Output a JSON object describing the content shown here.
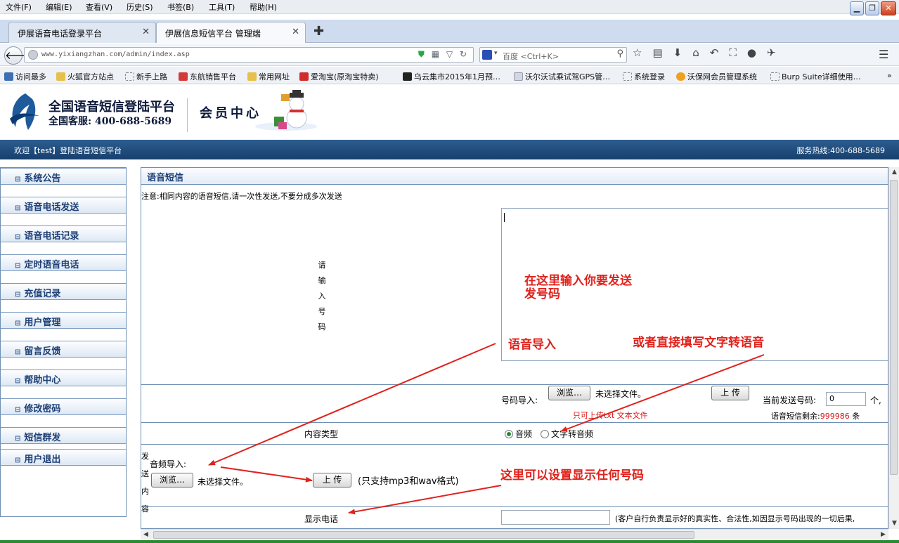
{
  "browser": {
    "menus": [
      "文件(F)",
      "编辑(E)",
      "查看(V)",
      "历史(S)",
      "书签(B)",
      "工具(T)",
      "帮助(H)"
    ],
    "tabs": [
      {
        "label": "伊展语音电话登录平台",
        "active": false
      },
      {
        "label": "伊展信息短信平台 管理端",
        "active": true
      }
    ],
    "url": "www.yixiangzhan.com/admin/index.asp",
    "search_placeholder": "百度 <Ctrl+K>",
    "bookmarks": [
      "访问最多",
      "火狐官方站点",
      "新手上路",
      "东航销售平台",
      "常用网址",
      "爱淘宝(原淘宝特卖)",
      "乌云集市2015年1月预…",
      "沃尔沃试乘试驾GPS管…",
      "系统登录",
      "沃保网会员管理系统",
      "Burp Suite详细使用…"
    ]
  },
  "site": {
    "brand_title": "全国语音短信登陆平台",
    "brand_service": "全国客服: 400-688-5689",
    "member_center": "会员中心",
    "welcome": "欢迎【test】登陆语音短信平台",
    "hotline": "服务热线:400-688-5689"
  },
  "sidebar": {
    "items": [
      "系统公告",
      "语音电话发送",
      "语音电话记录",
      "定时语音电话",
      "充值记录",
      "用户管理",
      "留言反馈",
      "帮助中心",
      "修改密码",
      "短信群发",
      "用户退出"
    ]
  },
  "main": {
    "title": "语音短信",
    "notice": "注意:相同内容的语音短信,请一次性发送,不要分成多次发送",
    "numbers_label": [
      "请",
      "输",
      "入",
      "号",
      "码"
    ],
    "import_label": "号码导入:",
    "browse_label": "浏览…",
    "no_file": "未选择文件。",
    "upload_label": "上 传",
    "upload_hint": "只可上传txt 文本文件",
    "current_label": "当前发送号码:",
    "current_value": "0",
    "current_unit": "个,",
    "remain_label": "语音短信剩余:",
    "remain_value": "999986",
    "remain_unit": "条",
    "content_type_label": "内容类型",
    "radio_audio": "音频",
    "radio_tts": "文字转音频",
    "send_content_label": [
      "发",
      "送",
      "内",
      "容"
    ],
    "audio_import_label": "音频导入:",
    "audio_hint": "(只支持mp3和wav格式)",
    "display_phone_label": "显示电话",
    "display_hint": "(客户自行负责显示好的真实性、合法性,如因显示号码出现的一切后果,"
  },
  "annotations": {
    "input_numbers": [
      "在这里输入你要发送",
      "发号码"
    ],
    "audio_import": "语音导入",
    "tts": "或者直接填写文字转语音",
    "display_any": "这里可以设置显示任何号码"
  },
  "colors": {
    "annotation_red": "#e0221c",
    "header_blue": "#1d3f75",
    "status_red": "#d91818"
  }
}
